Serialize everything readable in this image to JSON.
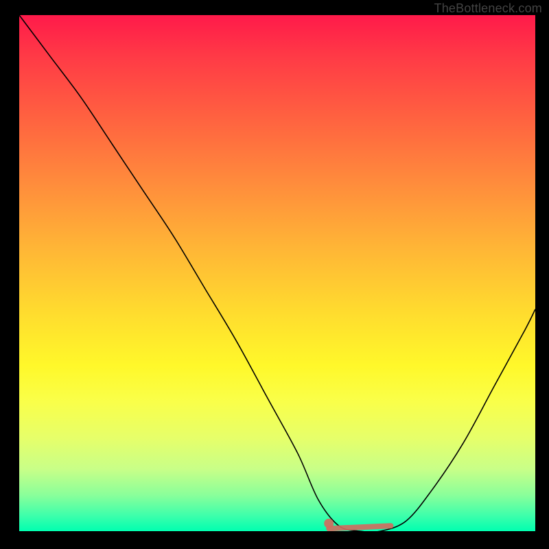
{
  "attribution": "TheBottleneck.com",
  "chart_data": {
    "type": "line",
    "title": "",
    "xlabel": "",
    "ylabel": "",
    "xlim": [
      0,
      100
    ],
    "ylim": [
      0,
      100
    ],
    "background": {
      "type": "vertical-gradient",
      "stops": [
        {
          "pct": 0,
          "color": "#ff1a4a"
        },
        {
          "pct": 50,
          "color": "#ffdd2e"
        },
        {
          "pct": 100,
          "color": "#00ffb0"
        }
      ]
    },
    "series": [
      {
        "name": "bottleneck-curve",
        "x": [
          0,
          6,
          12,
          18,
          24,
          30,
          36,
          42,
          48,
          54,
          58,
          62,
          66,
          70,
          75,
          80,
          86,
          92,
          98,
          100
        ],
        "values": [
          100,
          92,
          84,
          75,
          66,
          57,
          47,
          37,
          26,
          15,
          6,
          1,
          0,
          0,
          2,
          8,
          17,
          28,
          39,
          43
        ]
      }
    ],
    "highlight": {
      "description": "optimal-flat-region",
      "color": "#d46a5e",
      "x_start": 60,
      "x_end": 72,
      "y": 0.5,
      "dot_x": 60,
      "dot_y": 1.5
    },
    "legend": null,
    "grid": false
  }
}
